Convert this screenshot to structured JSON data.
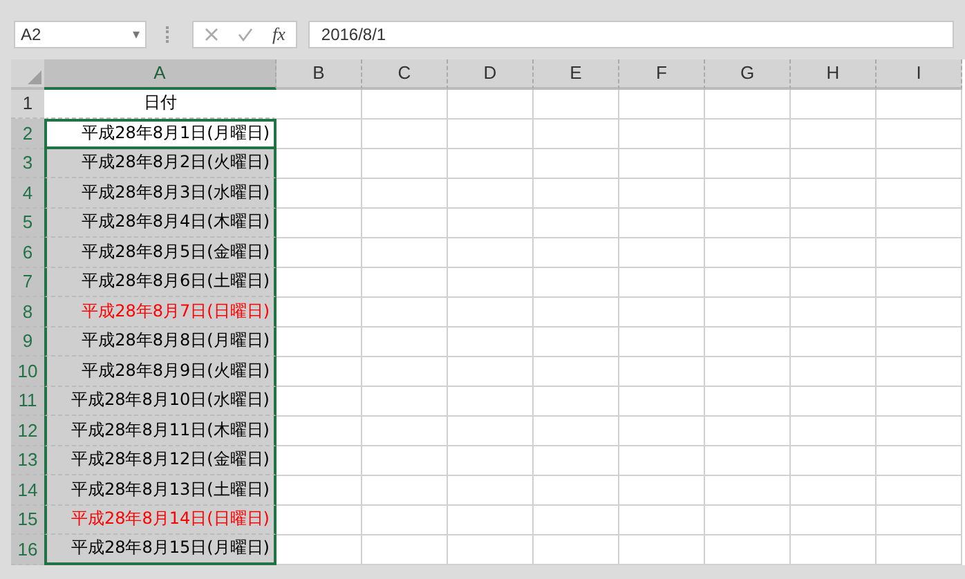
{
  "name_box": {
    "value": "A2",
    "dropdown": "▾"
  },
  "formula_bar": {
    "fx": "fx",
    "value": "2016/8/1"
  },
  "columns": [
    {
      "label": "A",
      "selected": true
    },
    {
      "label": "B",
      "selected": false
    },
    {
      "label": "C",
      "selected": false
    },
    {
      "label": "D",
      "selected": false
    },
    {
      "label": "E",
      "selected": false
    },
    {
      "label": "F",
      "selected": false
    },
    {
      "label": "G",
      "selected": false
    },
    {
      "label": "H",
      "selected": false
    },
    {
      "label": "I",
      "selected": false
    }
  ],
  "rows": [
    {
      "number": "1",
      "selected": false,
      "active": false,
      "text": "日付",
      "kind": "header",
      "color": "#000000"
    },
    {
      "number": "2",
      "selected": true,
      "active": true,
      "text": "平成28年8月1日(月曜日)",
      "kind": "date",
      "color": "#000000"
    },
    {
      "number": "3",
      "selected": true,
      "active": false,
      "text": "平成28年8月2日(火曜日)",
      "kind": "date",
      "color": "#000000"
    },
    {
      "number": "4",
      "selected": true,
      "active": false,
      "text": "平成28年8月3日(水曜日)",
      "kind": "date",
      "color": "#000000"
    },
    {
      "number": "5",
      "selected": true,
      "active": false,
      "text": "平成28年8月4日(木曜日)",
      "kind": "date",
      "color": "#000000"
    },
    {
      "number": "6",
      "selected": true,
      "active": false,
      "text": "平成28年8月5日(金曜日)",
      "kind": "date",
      "color": "#000000"
    },
    {
      "number": "7",
      "selected": true,
      "active": false,
      "text": "平成28年8月6日(土曜日)",
      "kind": "date",
      "color": "#000000"
    },
    {
      "number": "8",
      "selected": true,
      "active": false,
      "text": "平成28年8月7日(日曜日)",
      "kind": "date",
      "color": "#ff0000"
    },
    {
      "number": "9",
      "selected": true,
      "active": false,
      "text": "平成28年8月8日(月曜日)",
      "kind": "date",
      "color": "#000000"
    },
    {
      "number": "10",
      "selected": true,
      "active": false,
      "text": "平成28年8月9日(火曜日)",
      "kind": "date",
      "color": "#000000"
    },
    {
      "number": "11",
      "selected": true,
      "active": false,
      "text": "平成28年8月10日(水曜日)",
      "kind": "date",
      "color": "#000000"
    },
    {
      "number": "12",
      "selected": true,
      "active": false,
      "text": "平成28年8月11日(木曜日)",
      "kind": "date",
      "color": "#000000"
    },
    {
      "number": "13",
      "selected": true,
      "active": false,
      "text": "平成28年8月12日(金曜日)",
      "kind": "date",
      "color": "#000000"
    },
    {
      "number": "14",
      "selected": true,
      "active": false,
      "text": "平成28年8月13日(土曜日)",
      "kind": "date",
      "color": "#000000"
    },
    {
      "number": "15",
      "selected": true,
      "active": false,
      "text": "平成28年8月14日(日曜日)",
      "kind": "date",
      "color": "#ff0000"
    },
    {
      "number": "16",
      "selected": true,
      "active": false,
      "text": "平成28年8月15日(月曜日)",
      "kind": "date",
      "color": "#000000"
    }
  ]
}
